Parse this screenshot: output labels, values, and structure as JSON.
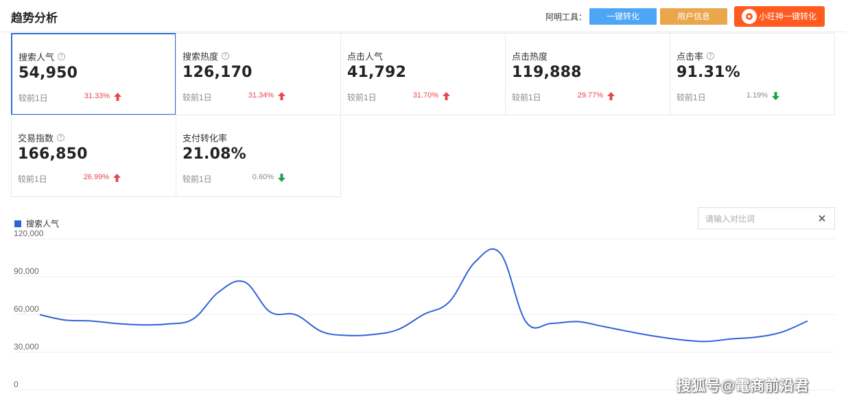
{
  "header": {
    "title": "趋势分析",
    "tools_label": "阿明工具：",
    "buttons": [
      "一键转化",
      "用户信息",
      "小旺神一键转化"
    ]
  },
  "metrics": [
    {
      "title": "搜索人气",
      "help": true,
      "value": "54,950",
      "compare": "较前1日",
      "pct": "31.33%",
      "dir": "up",
      "active": true
    },
    {
      "title": "搜索热度",
      "help": true,
      "value": "126,170",
      "compare": "较前1日",
      "pct": "31.34%",
      "dir": "up",
      "active": false
    },
    {
      "title": "点击人气",
      "help": false,
      "value": "41,792",
      "compare": "较前1日",
      "pct": "31.70%",
      "dir": "up",
      "active": false
    },
    {
      "title": "点击热度",
      "help": false,
      "value": "119,888",
      "compare": "较前1日",
      "pct": "29.77%",
      "dir": "up",
      "active": false
    },
    {
      "title": "点击率",
      "help": true,
      "value": "91.31%",
      "compare": "较前1日",
      "pct": "1.19%",
      "dir": "down",
      "active": false
    },
    {
      "title": "交易指数",
      "help": true,
      "value": "166,850",
      "compare": "较前1日",
      "pct": "26.99%",
      "dir": "up",
      "active": false
    },
    {
      "title": "支付转化率",
      "help": false,
      "value": "21.08%",
      "compare": "较前1日",
      "pct": "0.60%",
      "dir": "down",
      "active": false
    }
  ],
  "compare_input": {
    "placeholder": "请输入对比词",
    "value": ""
  },
  "watermark": "搜狐号@電商前沿君",
  "colors": {
    "line": "#2f62d8",
    "up": "#e5484d",
    "down": "#1aa44a",
    "active_border": "#2f6fcf"
  },
  "chart_data": {
    "type": "line",
    "series": [
      {
        "name": "搜索人气",
        "values": [
          59800,
          55500,
          54800,
          52800,
          51700,
          52400,
          56500,
          78000,
          85800,
          62000,
          59800,
          46500,
          43300,
          44000,
          48000,
          60000,
          70000,
          101500,
          108500,
          54000,
          52900,
          54300,
          50500,
          46500,
          42800,
          40000,
          38500,
          40500,
          42000,
          46000,
          54800
        ]
      }
    ],
    "ylim": [
      0,
      120000
    ],
    "yticks": [
      "0",
      "30,000",
      "60,000",
      "90,000",
      "120,000"
    ],
    "grid": true,
    "legend": "top-left"
  }
}
